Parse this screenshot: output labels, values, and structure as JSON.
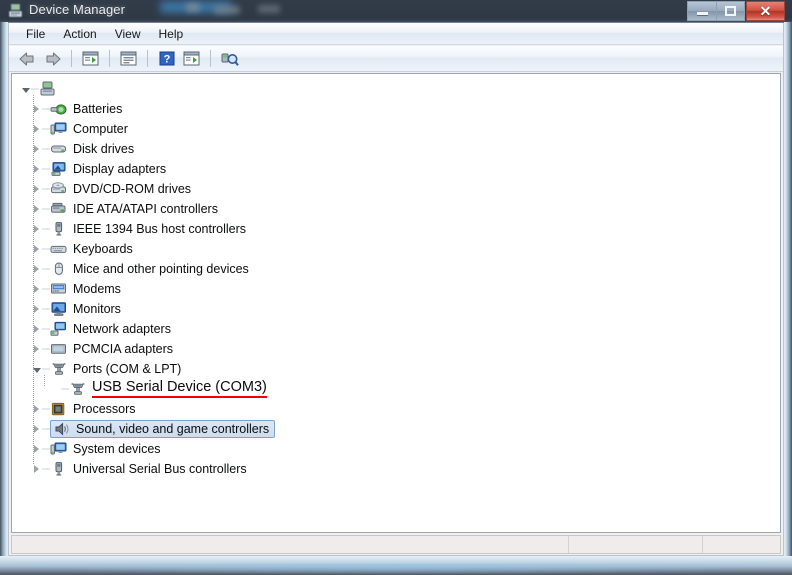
{
  "window": {
    "title": "Device Manager",
    "title_icon": "device-manager-icon",
    "controls": {
      "minimize": "–",
      "maximize": "□",
      "close": "✕"
    }
  },
  "menubar": {
    "items": [
      {
        "label": "File",
        "name": "menu-file"
      },
      {
        "label": "Action",
        "name": "menu-action"
      },
      {
        "label": "View",
        "name": "menu-view"
      },
      {
        "label": "Help",
        "name": "menu-help"
      }
    ]
  },
  "toolbar": {
    "buttons": [
      {
        "name": "back-button",
        "icon": "back-arrow-icon"
      },
      {
        "name": "forward-button",
        "icon": "forward-arrow-icon"
      },
      {
        "name": "show-hide-console-tree-button",
        "icon": "console-tree-icon"
      },
      {
        "name": "properties-button",
        "icon": "properties-icon"
      },
      {
        "name": "help-button",
        "icon": "help-question-icon"
      },
      {
        "name": "update-driver-button",
        "icon": "update-driver-icon"
      },
      {
        "name": "scan-hardware-changes-button",
        "icon": "scan-hardware-icon"
      }
    ]
  },
  "tree": {
    "root": {
      "label": "",
      "icon": "computer-root-icon",
      "expanded": true
    },
    "nodes": [
      {
        "label": "Batteries",
        "icon": "battery-icon",
        "state": "collapsed"
      },
      {
        "label": "Computer",
        "icon": "computer-icon",
        "state": "collapsed"
      },
      {
        "label": "Disk drives",
        "icon": "disk-drive-icon",
        "state": "collapsed"
      },
      {
        "label": "Display adapters",
        "icon": "display-adapter-icon",
        "state": "collapsed"
      },
      {
        "label": "DVD/CD-ROM drives",
        "icon": "dvd-drive-icon",
        "state": "collapsed"
      },
      {
        "label": "IDE ATA/ATAPI controllers",
        "icon": "ide-controller-icon",
        "state": "collapsed"
      },
      {
        "label": "IEEE 1394 Bus host controllers",
        "icon": "ieee1394-icon",
        "state": "collapsed"
      },
      {
        "label": "Keyboards",
        "icon": "keyboard-icon",
        "state": "collapsed"
      },
      {
        "label": "Mice and other pointing devices",
        "icon": "mouse-icon",
        "state": "collapsed"
      },
      {
        "label": "Modems",
        "icon": "modem-icon",
        "state": "collapsed"
      },
      {
        "label": "Monitors",
        "icon": "monitor-icon",
        "state": "collapsed"
      },
      {
        "label": "Network adapters",
        "icon": "network-adapter-icon",
        "state": "collapsed"
      },
      {
        "label": "PCMCIA adapters",
        "icon": "pcmcia-icon",
        "state": "collapsed"
      },
      {
        "label": "Ports (COM & LPT)",
        "icon": "port-icon",
        "state": "expanded"
      },
      {
        "label": "USB Serial Device (COM3)",
        "icon": "port-icon",
        "state": "leaf",
        "annotated": true
      },
      {
        "label": "Processors",
        "icon": "processor-icon",
        "state": "collapsed"
      },
      {
        "label": "Sound, video and game controllers",
        "icon": "sound-icon",
        "state": "collapsed",
        "selected": true
      },
      {
        "label": "System devices",
        "icon": "system-device-icon",
        "state": "collapsed"
      },
      {
        "label": "Universal Serial Bus controllers",
        "icon": "usb-icon",
        "state": "collapsed"
      }
    ]
  },
  "statusbar": {
    "panes": [
      "",
      "",
      ""
    ]
  },
  "colors": {
    "annotation_red": "#f00000",
    "selection_fill": "#cddcf0",
    "selection_border": "#7da2ce",
    "titlebar": "#2f3946",
    "close_button": "#cf5341"
  }
}
